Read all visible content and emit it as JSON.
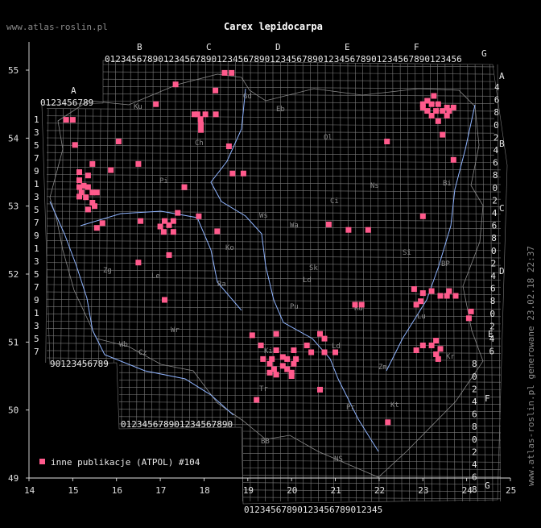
{
  "header": {
    "site": "www.atlas-roslin.pl",
    "title": "Carex lepidocarpa"
  },
  "side_note": "www.atlas-roslin.pl generowane 23.02.18 22:37",
  "legend": {
    "label": "inne publikacje (ATPOL) #104",
    "color": "#ff5a8c"
  },
  "colors": {
    "background": "#000000",
    "grid": "#7a7a7a",
    "rivers": "#8fb4ff",
    "points": "#ff5a8c"
  },
  "axes": {
    "x_ticks": [
      "14",
      "15",
      "16",
      "17",
      "18",
      "19",
      "20",
      "21",
      "22",
      "23",
      "24",
      "25"
    ],
    "y_ticks": [
      "55",
      "54",
      "53",
      "52",
      "51",
      "50",
      "49"
    ]
  },
  "grid_row_digits": "0123456789",
  "column_letters": [
    "A",
    "B",
    "C",
    "D",
    "E",
    "F",
    "G"
  ],
  "right_letters": [
    "A",
    "B",
    "C",
    "D",
    "E",
    "F",
    "G"
  ],
  "left_digits": [
    "1",
    "3",
    "5",
    "7",
    "9",
    "1",
    "3",
    "5",
    "7",
    "9",
    "1",
    "3",
    "5",
    "7",
    "9",
    "1",
    "3",
    "5",
    "7",
    "9"
  ],
  "region_codes": [
    "Ku",
    "Gd",
    "Eb",
    "Ch",
    "Ol",
    "Pi",
    "Ci",
    "Ns",
    "Bi",
    "Ws",
    "Wa",
    "Ko",
    "Sk",
    "Si",
    "Ld",
    "Zg",
    "Le",
    "BP",
    "Ra",
    "Lu",
    "Pu",
    "Wr",
    "Wb",
    "Cz",
    "Ki",
    "Ld",
    "Zm",
    "Kr",
    "Tr",
    "Pr",
    "Kt",
    "NS",
    "BB",
    "Rd"
  ],
  "occurrences": [
    [
      18.47,
      54.96
    ],
    [
      18.63,
      54.96
    ],
    [
      17.35,
      54.79
    ],
    [
      18.26,
      54.7
    ],
    [
      16.9,
      54.5
    ],
    [
      17.85,
      54.35
    ],
    [
      17.78,
      54.35
    ],
    [
      17.92,
      54.28
    ],
    [
      18.03,
      54.35
    ],
    [
      18.27,
      54.35
    ],
    [
      17.93,
      54.2
    ],
    [
      17.93,
      54.12
    ],
    [
      14.85,
      54.27
    ],
    [
      15.0,
      54.27
    ],
    [
      15.05,
      53.9
    ],
    [
      16.05,
      53.95
    ],
    [
      16.5,
      53.62
    ],
    [
      18.57,
      53.88
    ],
    [
      22.18,
      53.95
    ],
    [
      23.0,
      54.5
    ],
    [
      23.1,
      54.55
    ],
    [
      23.25,
      54.62
    ],
    [
      23.2,
      54.5
    ],
    [
      23.35,
      54.5
    ],
    [
      23.0,
      54.45
    ],
    [
      23.1,
      54.4
    ],
    [
      23.2,
      54.33
    ],
    [
      23.3,
      54.4
    ],
    [
      23.45,
      54.4
    ],
    [
      23.55,
      54.45
    ],
    [
      23.6,
      54.4
    ],
    [
      23.7,
      54.45
    ],
    [
      23.55,
      54.33
    ],
    [
      23.35,
      54.25
    ],
    [
      23.45,
      54.05
    ],
    [
      23.7,
      53.68
    ],
    [
      15.15,
      53.5
    ],
    [
      15.35,
      53.45
    ],
    [
      15.45,
      53.62
    ],
    [
      15.87,
      53.53
    ],
    [
      15.15,
      53.38
    ],
    [
      15.25,
      53.3
    ],
    [
      15.15,
      53.28
    ],
    [
      15.35,
      53.28
    ],
    [
      15.2,
      53.2
    ],
    [
      15.45,
      53.2
    ],
    [
      15.55,
      53.2
    ],
    [
      15.15,
      53.14
    ],
    [
      15.3,
      53.13
    ],
    [
      15.45,
      53.05
    ],
    [
      15.5,
      53.0
    ],
    [
      15.35,
      52.95
    ],
    [
      17.55,
      53.28
    ],
    [
      18.65,
      53.48
    ],
    [
      18.9,
      53.48
    ],
    [
      17.4,
      52.9
    ],
    [
      17.3,
      52.78
    ],
    [
      17.1,
      52.78
    ],
    [
      17.2,
      52.72
    ],
    [
      17.0,
      52.7
    ],
    [
      17.08,
      52.62
    ],
    [
      17.3,
      52.62
    ],
    [
      16.55,
      52.78
    ],
    [
      17.88,
      52.85
    ],
    [
      18.3,
      52.63
    ],
    [
      15.68,
      52.75
    ],
    [
      15.55,
      52.68
    ],
    [
      20.85,
      52.73
    ],
    [
      21.3,
      52.65
    ],
    [
      21.75,
      52.65
    ],
    [
      23.0,
      52.85
    ],
    [
      17.2,
      52.28
    ],
    [
      16.5,
      52.17
    ],
    [
      22.8,
      51.78
    ],
    [
      23.0,
      51.72
    ],
    [
      23.2,
      51.75
    ],
    [
      23.4,
      51.68
    ],
    [
      23.55,
      51.68
    ],
    [
      23.6,
      51.75
    ],
    [
      23.75,
      51.68
    ],
    [
      22.95,
      51.6
    ],
    [
      22.85,
      51.55
    ],
    [
      24.1,
      51.45
    ],
    [
      24.05,
      51.35
    ],
    [
      17.1,
      51.62
    ],
    [
      21.45,
      51.55
    ],
    [
      21.6,
      51.55
    ],
    [
      20.65,
      51.12
    ],
    [
      20.75,
      51.05
    ],
    [
      19.1,
      51.1
    ],
    [
      19.65,
      51.12
    ],
    [
      20.35,
      50.95
    ],
    [
      20.45,
      50.85
    ],
    [
      20.75,
      50.85
    ],
    [
      21.0,
      50.85
    ],
    [
      19.3,
      50.95
    ],
    [
      19.65,
      50.88
    ],
    [
      20.05,
      50.88
    ],
    [
      19.35,
      50.75
    ],
    [
      19.55,
      50.75
    ],
    [
      19.8,
      50.78
    ],
    [
      19.9,
      50.75
    ],
    [
      20.05,
      50.68
    ],
    [
      19.5,
      50.68
    ],
    [
      19.6,
      50.6
    ],
    [
      19.8,
      50.65
    ],
    [
      19.9,
      50.6
    ],
    [
      19.5,
      50.55
    ],
    [
      19.65,
      50.52
    ],
    [
      20.0,
      50.5
    ],
    [
      19.2,
      50.15
    ],
    [
      20.65,
      50.3
    ],
    [
      20.1,
      50.75
    ],
    [
      20.0,
      50.55
    ],
    [
      22.85,
      50.88
    ],
    [
      23.2,
      50.95
    ],
    [
      23.3,
      51.02
    ],
    [
      23.0,
      50.95
    ],
    [
      23.4,
      50.9
    ],
    [
      23.3,
      50.82
    ],
    [
      23.35,
      50.75
    ],
    [
      22.2,
      49.82
    ]
  ]
}
